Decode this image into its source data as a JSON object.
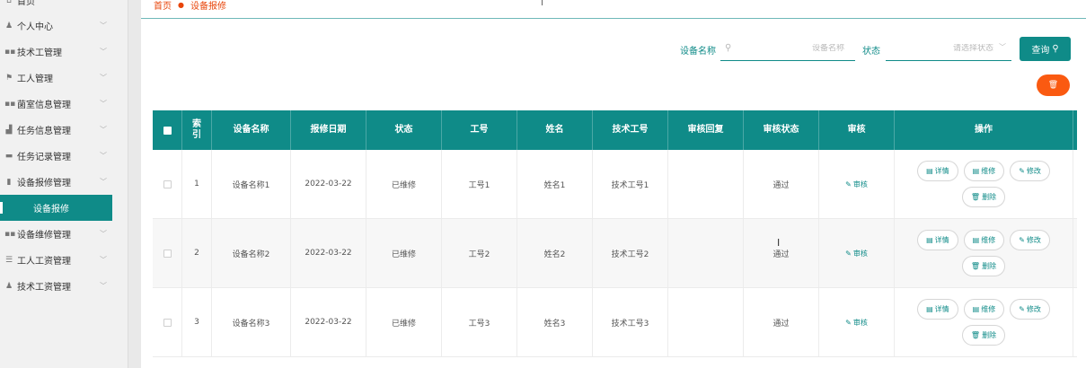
{
  "sidebar": {
    "items": [
      {
        "label": "首页",
        "icon": "home-icon",
        "glyph": "⌂",
        "chevron": false
      },
      {
        "label": "个人中心",
        "icon": "user-icon",
        "glyph": "♟",
        "chevron": true
      },
      {
        "label": "技术工管理",
        "icon": "grid-icon",
        "glyph": "▪▪",
        "chevron": true
      },
      {
        "label": "工人管理",
        "icon": "flag-icon",
        "glyph": "⚑",
        "chevron": true
      },
      {
        "label": "菌室信息管理",
        "icon": "grid-icon",
        "glyph": "▪▪",
        "chevron": true
      },
      {
        "label": "任务信息管理",
        "icon": "chart-icon",
        "glyph": "▟",
        "chevron": true
      },
      {
        "label": "任务记录管理",
        "icon": "folder-icon",
        "glyph": "▬",
        "chevron": true
      },
      {
        "label": "设备报修管理",
        "icon": "bar-chart-icon",
        "glyph": "▮",
        "chevron": true
      },
      {
        "label": "设备维修管理",
        "icon": "grid-icon",
        "glyph": "▪▪",
        "chevron": true
      },
      {
        "label": "工人工资管理",
        "icon": "sliders-icon",
        "glyph": "☰",
        "chevron": true
      },
      {
        "label": "技术工资管理",
        "icon": "user-icon",
        "glyph": "♟",
        "chevron": true
      }
    ],
    "active_sub": "设备报修"
  },
  "breadcrumb": {
    "home": "首页",
    "current": "设备报修"
  },
  "search": {
    "name_label": "设备名称",
    "name_placeholder": "设备名称",
    "status_label": "状态",
    "status_placeholder": "请选择状态",
    "query_label": "查询"
  },
  "table": {
    "headers": [
      "索引",
      "设备名称",
      "报修日期",
      "状态",
      "工号",
      "姓名",
      "技术工号",
      "审核回复",
      "审核状态",
      "审核",
      "操作"
    ],
    "audit_label": "审核",
    "ops": {
      "detail": "详情",
      "repair": "维修",
      "edit": "修改",
      "delete": "删除"
    },
    "rows": [
      {
        "index": "1",
        "name": "设备名称1",
        "date": "2022-03-22",
        "status": "已维修",
        "emp_no": "工号1",
        "emp_name": "姓名1",
        "tech_no": "技术工号1",
        "reply": "",
        "audit_status": "通过"
      },
      {
        "index": "2",
        "name": "设备名称2",
        "date": "2022-03-22",
        "status": "已维修",
        "emp_no": "工号2",
        "emp_name": "姓名2",
        "tech_no": "技术工号2",
        "reply": "",
        "audit_status": "通过"
      },
      {
        "index": "3",
        "name": "设备名称3",
        "date": "2022-03-22",
        "status": "已维修",
        "emp_no": "工号3",
        "emp_name": "姓名3",
        "tech_no": "技术工号3",
        "reply": "",
        "audit_status": "通过"
      }
    ]
  },
  "colors": {
    "accent": "#0f8b88",
    "danger": "#fa5a11",
    "breadcrumb": "#e8450a"
  }
}
